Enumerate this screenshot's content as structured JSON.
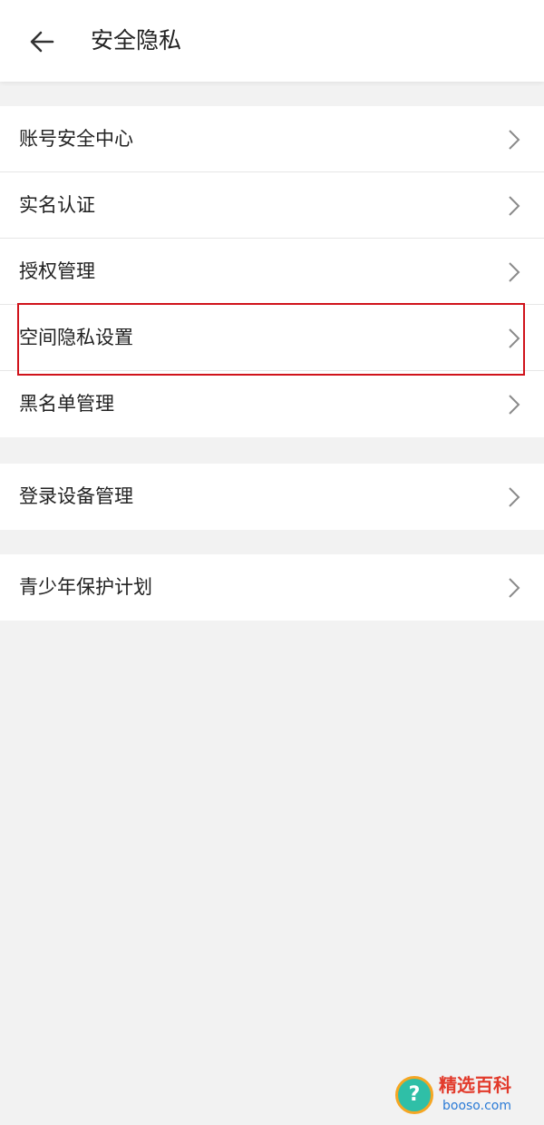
{
  "header": {
    "title": "安全隐私"
  },
  "groups": [
    {
      "items": [
        {
          "label": "账号安全中心"
        },
        {
          "label": "实名认证"
        },
        {
          "label": "授权管理"
        },
        {
          "label": "空间隐私设置"
        },
        {
          "label": "黑名单管理"
        }
      ]
    },
    {
      "items": [
        {
          "label": "登录设备管理"
        }
      ]
    },
    {
      "items": [
        {
          "label": "青少年保护计划"
        }
      ]
    }
  ],
  "colors": {
    "highlight": "#d0131b",
    "background": "#f2f2f2",
    "row_bg": "#ffffff",
    "text": "#222222"
  },
  "watermark": {
    "text": "精选百科",
    "url": "booso.com"
  }
}
